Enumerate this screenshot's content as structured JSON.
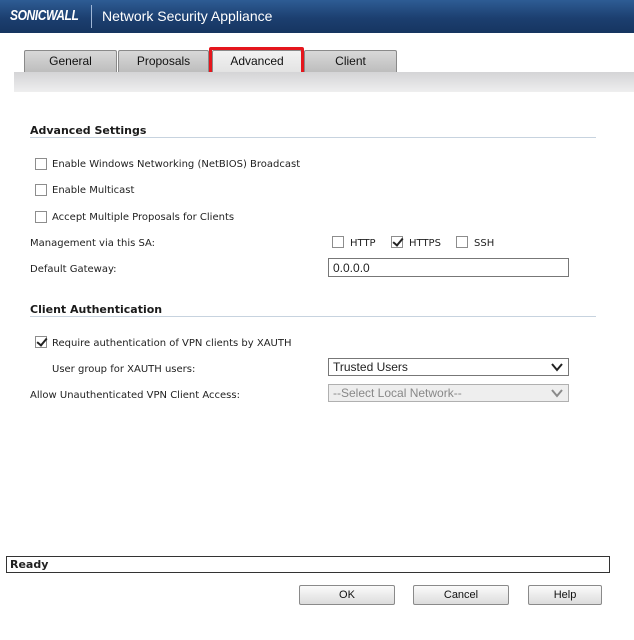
{
  "header": {
    "logo": "SONICWALL",
    "title": "Network Security Appliance"
  },
  "tabs": [
    {
      "label": "General",
      "active": false
    },
    {
      "label": "Proposals",
      "active": false
    },
    {
      "label": "Advanced",
      "active": true
    },
    {
      "label": "Client",
      "active": false
    }
  ],
  "advanced_settings": {
    "title": "Advanced Settings",
    "netbios": {
      "label": "Enable Windows Networking (NetBIOS) Broadcast",
      "checked": false
    },
    "multicast": {
      "label": "Enable Multicast",
      "checked": false
    },
    "multiple_proposals": {
      "label": "Accept Multiple Proposals for Clients",
      "checked": false
    },
    "management": {
      "label": "Management via this SA:",
      "http": {
        "label": "HTTP",
        "checked": false
      },
      "https": {
        "label": "HTTPS",
        "checked": true
      },
      "ssh": {
        "label": "SSH",
        "checked": false
      }
    },
    "default_gateway": {
      "label": "Default Gateway:",
      "value": "0.0.0.0"
    }
  },
  "client_auth": {
    "title": "Client Authentication",
    "require_xauth": {
      "label": "Require authentication of VPN clients by XAUTH",
      "checked": true
    },
    "user_group": {
      "label": "User group for XAUTH users:",
      "value": "Trusted Users"
    },
    "unauth_access": {
      "label": "Allow Unauthenticated VPN Client Access:",
      "value": "--Select Local Network--"
    }
  },
  "status": "Ready",
  "buttons": {
    "ok": "OK",
    "cancel": "Cancel",
    "help": "Help"
  }
}
